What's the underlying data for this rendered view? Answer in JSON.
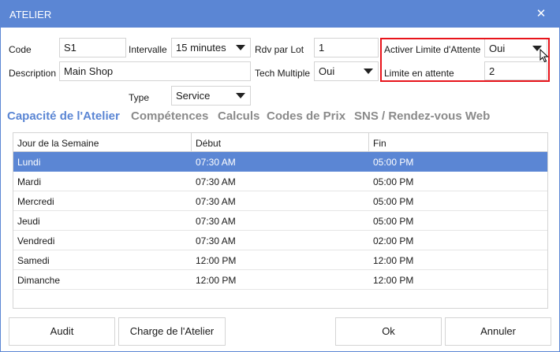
{
  "window": {
    "title": "ATELIER",
    "close_glyph": "✕"
  },
  "form": {
    "code_label": "Code",
    "code_value": "S1",
    "intervalle_label": "Intervalle",
    "intervalle_value": "15 minutes",
    "rdv_label": "Rdv par Lot",
    "rdv_value": "1",
    "activer_label": "Activer Limite d'Attente",
    "activer_value": "Oui",
    "description_label": "Description",
    "description_value": "Main Shop",
    "tech_label": "Tech Multiple",
    "tech_value": "Oui",
    "limite_label": "Limite en attente",
    "limite_value": "2",
    "type_label": "Type",
    "type_value": "Service"
  },
  "tabs": [
    {
      "label": "Capacité de l'Atelier",
      "active": true
    },
    {
      "label": "Compétences",
      "active": false
    },
    {
      "label": "Calculs",
      "active": false
    },
    {
      "label": "Codes de Prix",
      "active": false
    },
    {
      "label": "SNS / Rendez-vous Web",
      "active": false
    }
  ],
  "grid": {
    "headers": [
      "Jour de la Semaine",
      "Début",
      "Fin"
    ],
    "rows": [
      {
        "day": "Lundi",
        "start": "07:30 AM",
        "end": "05:00 PM",
        "selected": true
      },
      {
        "day": "Mardi",
        "start": "07:30 AM",
        "end": "05:00 PM",
        "selected": false
      },
      {
        "day": "Mercredi",
        "start": "07:30 AM",
        "end": "05:00 PM",
        "selected": false
      },
      {
        "day": "Jeudi",
        "start": "07:30 AM",
        "end": "05:00 PM",
        "selected": false
      },
      {
        "day": "Vendredi",
        "start": "07:30 AM",
        "end": "02:00 PM",
        "selected": false
      },
      {
        "day": "Samedi",
        "start": "12:00 PM",
        "end": "12:00 PM",
        "selected": false
      },
      {
        "day": "Dimanche",
        "start": "12:00 PM",
        "end": "12:00 PM",
        "selected": false
      }
    ]
  },
  "buttons": {
    "audit": "Audit",
    "charge": "Charge de l'Atelier",
    "ok": "Ok",
    "annuler": "Annuler"
  },
  "colors": {
    "accent": "#5b86d4",
    "highlight_border": "#e8141b",
    "inactive_tab": "#8a8a8a"
  },
  "icons": {
    "close": "close-icon",
    "dropdown": "chevron-down-icon",
    "cursor": "mouse-pointer-icon"
  }
}
